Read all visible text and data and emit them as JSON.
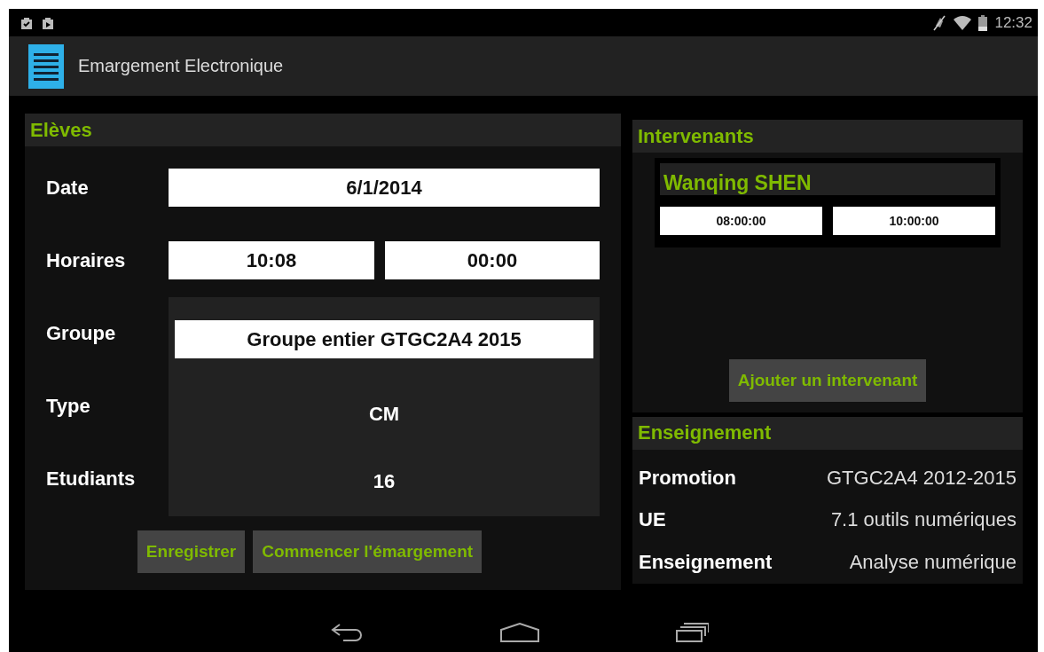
{
  "status_bar": {
    "time": "12:32"
  },
  "action_bar": {
    "title": "Emargement Electronique"
  },
  "eleves": {
    "title": "Elèves",
    "date": {
      "label": "Date",
      "value": "6/1/2014"
    },
    "horaires": {
      "label": "Horaires",
      "start": "10:08",
      "end": "00:00"
    },
    "groupe": {
      "label": "Groupe",
      "value": "Groupe entier GTGC2A4 2015"
    },
    "type": {
      "label": "Type",
      "value": "CM"
    },
    "etudiants": {
      "label": "Etudiants",
      "value": "16"
    },
    "buttons": [
      "Enregistrer",
      "Commencer l'émargement"
    ]
  },
  "intervenants": {
    "title": "Intervenants",
    "items": [
      {
        "name": "Wanqing SHEN",
        "start": "08:00:00",
        "end": "10:00:00"
      }
    ],
    "add_button": "Ajouter un intervenant"
  },
  "enseignement": {
    "title": "Enseignement",
    "rows": [
      {
        "label": "Promotion",
        "value": "GTGC2A4 2012-2015"
      },
      {
        "label": "UE",
        "value": "7.1 outils numériques"
      },
      {
        "label": "Enseignement",
        "value": "Analyse numérique"
      }
    ]
  }
}
